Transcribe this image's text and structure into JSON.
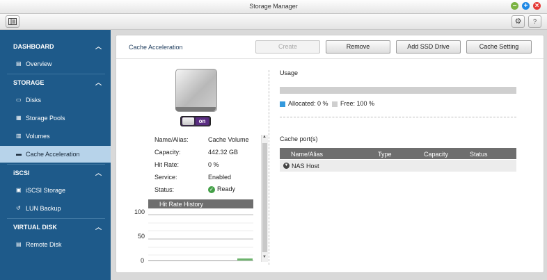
{
  "window": {
    "title": "Storage Manager"
  },
  "sidebar": {
    "sections": [
      {
        "label": "DASHBOARD",
        "items": [
          {
            "label": "Overview"
          }
        ]
      },
      {
        "label": "STORAGE",
        "items": [
          {
            "label": "Disks"
          },
          {
            "label": "Storage Pools"
          },
          {
            "label": "Volumes"
          },
          {
            "label": "Cache Acceleration"
          }
        ]
      },
      {
        "label": "iSCSI",
        "items": [
          {
            "label": "iSCSI Storage"
          },
          {
            "label": "LUN Backup"
          }
        ]
      },
      {
        "label": "VIRTUAL DISK",
        "items": [
          {
            "label": "Remote Disk"
          }
        ]
      }
    ],
    "selected": "Cache Acceleration"
  },
  "toolbar": {
    "help_label": "?"
  },
  "panel": {
    "title": "Cache Acceleration",
    "buttons": {
      "create": "Create",
      "remove": "Remove",
      "add_ssd": "Add SSD Drive",
      "cache_setting": "Cache Setting"
    },
    "toggle_label": "on",
    "properties": [
      {
        "label": "Name/Alias:",
        "value": "Cache Volume"
      },
      {
        "label": "Capacity:",
        "value": "442.32 GB"
      },
      {
        "label": "Hit Rate:",
        "value": "0 %"
      },
      {
        "label": "Service:",
        "value": "Enabled"
      },
      {
        "label": "Status:",
        "value": "Ready"
      }
    ],
    "hit_rate_history": {
      "title": "Hit Rate History",
      "y_ticks": [
        "100",
        "50",
        "0"
      ]
    },
    "usage": {
      "title": "Usage",
      "allocated_label": "Allocated: 0 %",
      "free_label": "Free: 100 %",
      "allocated_fraction": 0,
      "allocated_color": "#3399dd",
      "free_color": "#cfcfcf"
    },
    "cache_ports": {
      "title": "Cache port(s)",
      "columns": [
        "Name/Alias",
        "Type",
        "Capacity",
        "Status"
      ],
      "rows": [
        {
          "name": "NAS Host",
          "type": "",
          "capacity": "",
          "status": ""
        }
      ]
    }
  }
}
